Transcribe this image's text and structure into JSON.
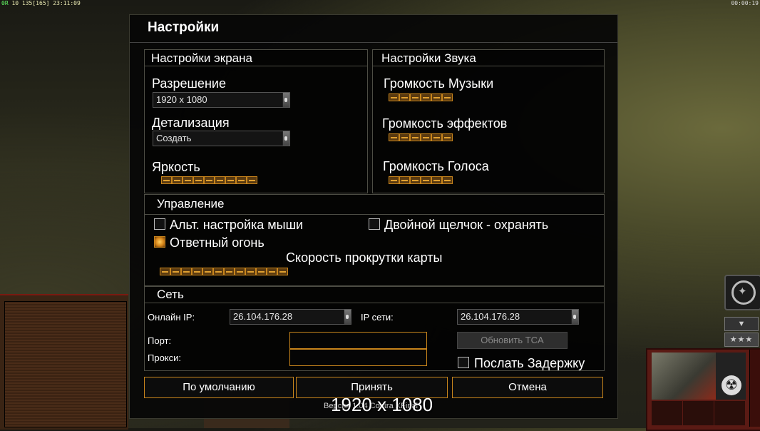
{
  "hud": {
    "top_left_a": "0R",
    "top_left_b": "10 135[165] 23:11:09",
    "top_right": "00:00:19"
  },
  "dialog": {
    "title": "Настройки"
  },
  "display": {
    "header": "Настройки экрана",
    "resolution_label": "Разрешение",
    "resolution_value": "1920 x 1080",
    "detail_label": "Детализация",
    "detail_value": "Создать",
    "brightness_label": "Яркость",
    "brightness_level": 9
  },
  "sound": {
    "header": "Настройки Звука",
    "music_label": "Громкость Музыки",
    "music_level": 6,
    "effects_label": "Громкость эффектов",
    "effects_level": 6,
    "voice_label": "Громкость Голоса",
    "voice_level": 6
  },
  "controls": {
    "header": "Управление",
    "alt_mouse_label": "Альт. настройка мыши",
    "alt_mouse_checked": false,
    "double_click_label": "Двойной щелчок - охранять",
    "double_click_checked": false,
    "return_fire_label": "Ответный огонь",
    "return_fire_checked": true,
    "scroll_speed_label": "Скорость прокрутки карты",
    "scroll_speed_level": 12
  },
  "network": {
    "header": "Сеть",
    "online_ip_label": "Онлайн IP:",
    "online_ip_value": "26.104.176.28",
    "lan_ip_label": "IP сети:",
    "lan_ip_value": "26.104.176.28",
    "port_label": "Порт:",
    "port_value": "",
    "proxy_label": "Прокси:",
    "proxy_value": "",
    "update_tca_label": "Обновить TCA",
    "send_delay_label": "Послать Задержку",
    "send_delay_checked": false
  },
  "buttons": {
    "defaults": "По умолчанию",
    "accept": "Принять",
    "cancel": "Отмена"
  },
  "overlay": {
    "resolution_text": "1920 x 1080",
    "version_text": "Версия 1.04 Contra XFinal"
  },
  "colors": {
    "accent": "#c8851c",
    "dialog_bg": "#060606",
    "border": "#4d4d44"
  }
}
